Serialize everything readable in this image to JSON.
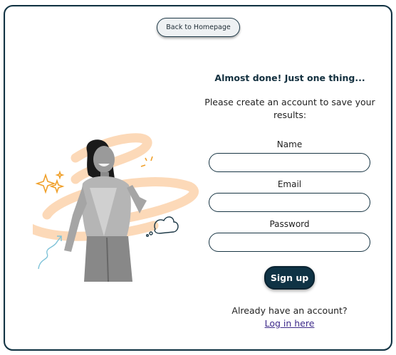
{
  "nav": {
    "back_label": "Back to Homepage"
  },
  "signup": {
    "heading": "Almost done! Just one thing...",
    "subtext": "Please create an account to save your results:",
    "fields": [
      {
        "label": "Name",
        "value": "",
        "placeholder": ""
      },
      {
        "label": "Email",
        "value": "",
        "placeholder": ""
      },
      {
        "label": "Password",
        "value": "",
        "placeholder": ""
      }
    ],
    "submit_label": "Sign up",
    "login_prompt": "Already have an account?",
    "login_link": "Log in here"
  },
  "colors": {
    "primary": "#0f3345",
    "border": "#183544",
    "link": "#3d2a8a",
    "swirl": "#fcd9b8",
    "sparkle": "#f0a02a"
  },
  "illustration": {
    "icons": [
      "sparkle-icon",
      "cloud-icon",
      "arrow-icon",
      "person-photo"
    ]
  }
}
